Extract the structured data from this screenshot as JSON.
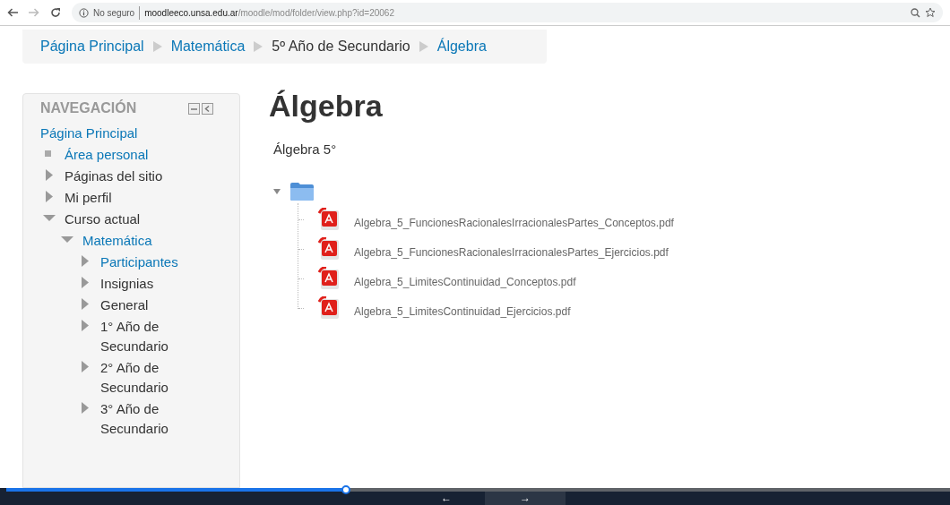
{
  "browser": {
    "security": "No seguro",
    "url_host": "moodleeco.unsa.edu.ar",
    "url_path": "/moodle/mod/folder/view.php?id=20062"
  },
  "breadcrumb": [
    {
      "label": "Página Principal",
      "link": true
    },
    {
      "label": "Matemática",
      "link": true
    },
    {
      "label": "5º Año de Secundario",
      "link": false
    },
    {
      "label": "Álgebra",
      "link": true
    }
  ],
  "navigation": {
    "title": "NAVEGACIÓN",
    "items": [
      {
        "label": "Página Principal",
        "kind": "root",
        "link": true
      },
      {
        "label": "Área personal",
        "kind": "leaf",
        "link": true
      },
      {
        "label": "Páginas del sitio",
        "kind": "branch",
        "expanded": false,
        "link": false
      },
      {
        "label": "Mi perfil",
        "kind": "branch",
        "expanded": false,
        "link": false
      },
      {
        "label": "Curso actual",
        "kind": "branch",
        "expanded": true,
        "link": false,
        "children": [
          {
            "label": "Matemática",
            "kind": "branch",
            "expanded": true,
            "link": true,
            "children": [
              {
                "label": "Participantes",
                "kind": "branch",
                "expanded": false,
                "link": true
              },
              {
                "label": "Insignias",
                "kind": "branch",
                "expanded": false,
                "link": false
              },
              {
                "label": "General",
                "kind": "branch",
                "expanded": false,
                "link": false
              },
              {
                "label": "1° Año de Secundario",
                "kind": "branch",
                "expanded": false,
                "link": false
              },
              {
                "label": "2° Año de Secundario",
                "kind": "branch",
                "expanded": false,
                "link": false
              },
              {
                "label": "3° Año de Secundario",
                "kind": "branch",
                "expanded": false,
                "link": false
              }
            ]
          }
        ]
      }
    ]
  },
  "main": {
    "title": "Álgebra",
    "description": "Álgebra 5°",
    "folder": {
      "expanded": true,
      "files": [
        "Algebra_5_FuncionesRacionalesIrracionalesPartes_Conceptos.pdf",
        "Algebra_5_FuncionesRacionalesIrracionalesPartes_Ejercicios.pdf",
        "Algebra_5_LimitesContinuidad_Conceptos.pdf",
        "Algebra_5_LimitesContinuidad_Ejercicios.pdf"
      ]
    }
  },
  "player": {
    "level": 0.36,
    "prev": "←",
    "next": "→"
  }
}
